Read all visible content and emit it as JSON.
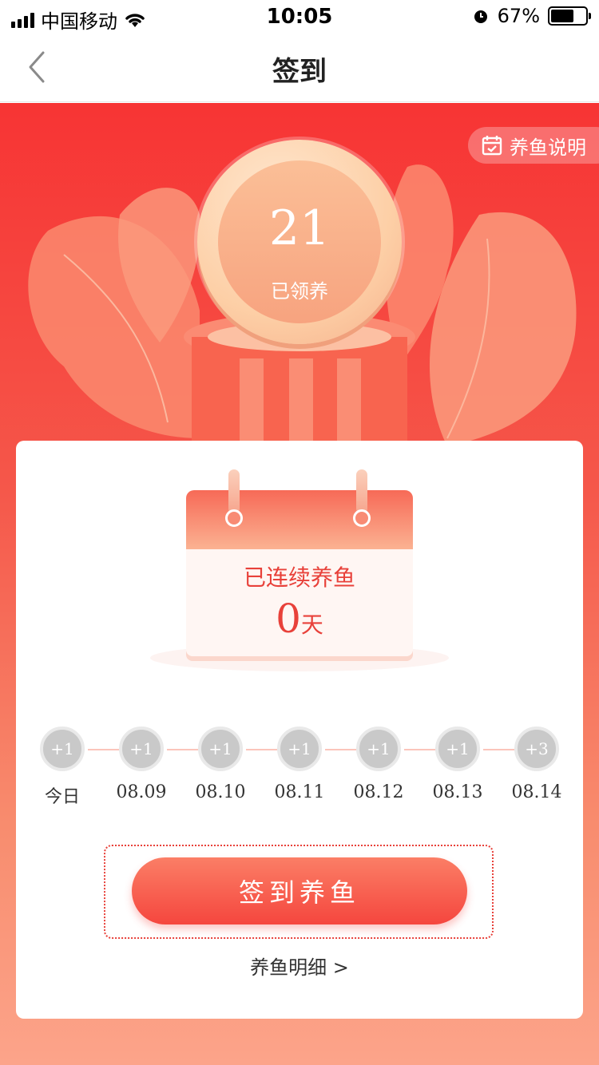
{
  "status_bar": {
    "carrier": "中国移动",
    "time": "10:05",
    "battery": "67%",
    "battery_level": 0.67
  },
  "nav": {
    "title": "签到"
  },
  "hero": {
    "rules_label": "养鱼说明",
    "coin_value": "21",
    "coin_label": "已领养"
  },
  "calendar": {
    "title": "已连续养鱼",
    "days": "0",
    "unit": "天"
  },
  "days": [
    {
      "reward": "+1",
      "date": "今日"
    },
    {
      "reward": "+1",
      "date": "08.09"
    },
    {
      "reward": "+1",
      "date": "08.10"
    },
    {
      "reward": "+1",
      "date": "08.11"
    },
    {
      "reward": "+1",
      "date": "08.12"
    },
    {
      "reward": "+1",
      "date": "08.13"
    },
    {
      "reward": "+3",
      "date": "08.14"
    }
  ],
  "actions": {
    "checkin_button": "签到养鱼",
    "detail_link": "养鱼明细 >"
  },
  "colors": {
    "accent": "#f5463e",
    "hero_top": "#f73434",
    "hero_bottom": "#fca48a"
  }
}
